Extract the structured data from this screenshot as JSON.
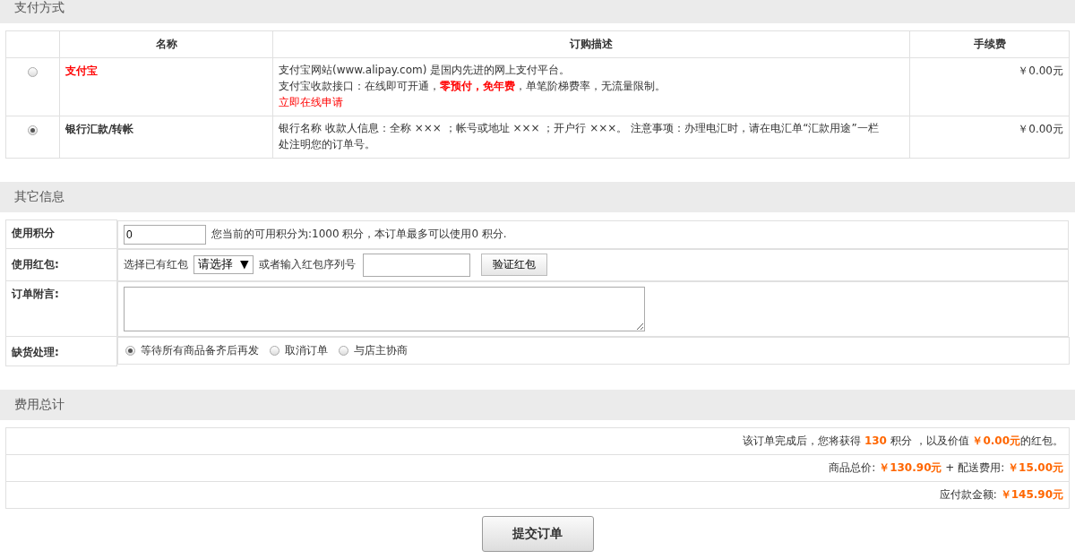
{
  "payment": {
    "title": "支付方式",
    "columns": [
      "名称",
      "订购描述",
      "手续费"
    ],
    "rows": [
      {
        "selected": false,
        "kind": "promoted",
        "name": "支付宝",
        "description": [
          "支付宝网站(www.alipay.com) 是国内先进的网上支付平台。",
          "支付宝收款接口：在线即可开通，**零预付，免年费**，单笔阶梯费率，无流量限制。"
        ],
        "link": "立即在线申请",
        "fee": "￥0.00元"
      },
      {
        "selected": true,
        "kind": "normal",
        "name": "银行汇款/转帐",
        "description": [
          "银行名称 收款人信息：全称 ××× ；帐号或地址 ××× ；开户行 ×××。 注意事项：办理电汇时，请在电汇单“汇款用途”一栏处注明您的订单号。"
        ],
        "fee": "￥0.00元"
      }
    ]
  },
  "other": {
    "title": "其它信息",
    "rows": [
      {
        "kind": "points",
        "label": "使用积分",
        "value": "0",
        "note": "您当前的可用积分为:1000 积分，本订单最多可以使用0 积分."
      },
      {
        "kind": "bonus",
        "label": "使用红包:",
        "select_label": "选择已有红包",
        "select_value": "请选择",
        "caret": "▼",
        "or_label": "或者输入红包序列号",
        "button": "验证红包"
      },
      {
        "kind": "message",
        "label": "订单附言:"
      },
      {
        "kind": "shortage",
        "label": "缺货处理:",
        "options": [
          {
            "label": "等待所有商品备齐后再发",
            "selected": true
          },
          {
            "label": "取消订单",
            "selected": false
          },
          {
            "label": "与店主协商",
            "selected": false
          }
        ]
      }
    ]
  },
  "totals": {
    "title": "费用总计",
    "lines": [
      "该订单完成后，您将获得 **130** 积分 ，以及价值 **￥0.00元**的红包。",
      "商品总价: **￥130.90元** + 配送费用: **￥15.00元**",
      "应付款金额: **￥145.90元**"
    ]
  },
  "submit": "提交订单"
}
